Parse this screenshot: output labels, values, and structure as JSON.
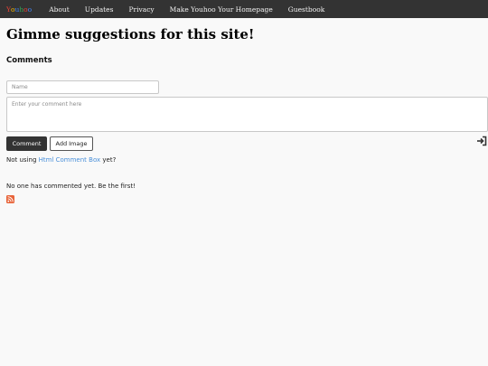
{
  "nav": {
    "brand_letters": [
      "Y",
      "o",
      "u",
      "h",
      "o",
      "o"
    ],
    "brand_colors": [
      "#ea4335",
      "#fbbc05",
      "#4285f4",
      "#34a853",
      "#ea4335",
      "#4285f4"
    ],
    "links": [
      "About",
      "Updates",
      "Privacy",
      "Make Youhoo Your Homepage",
      "Guestbook"
    ]
  },
  "page": {
    "title": "Gimme suggestions for this site!"
  },
  "comments": {
    "heading": "Comments",
    "name_placeholder": "Name",
    "comment_placeholder": "Enter your comment here",
    "comment_button": "Comment",
    "add_image_button": "Add Image",
    "promo_prefix": "Not using ",
    "promo_link": "Html Comment Box",
    "promo_suffix": "  yet?",
    "empty_message": "No one has commented yet. Be the first!"
  },
  "icons": {
    "login": "login-icon",
    "rss": "rss-icon"
  },
  "colors": {
    "navbar": "#333333",
    "link": "#4a90d9",
    "rss": "#e8643a"
  }
}
